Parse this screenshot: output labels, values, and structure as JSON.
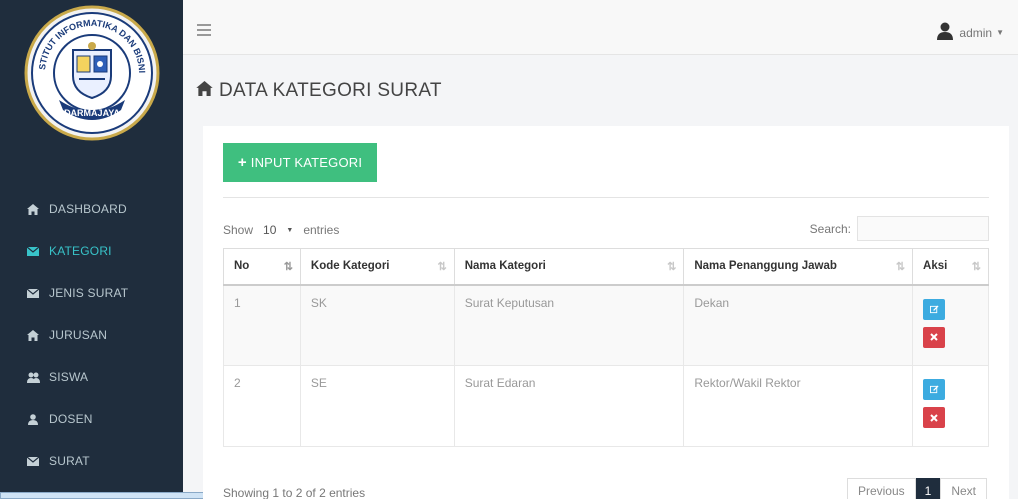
{
  "sidebar": {
    "logo_text_top": "INSTITUT INFORMATIKA DAN BISNIS",
    "logo_text_bottom": "DARMAJAYA",
    "items": [
      {
        "label": "DASHBOARD",
        "icon": "home-icon"
      },
      {
        "label": "KATEGORI",
        "icon": "envelope-icon",
        "active": true
      },
      {
        "label": "JENIS SURAT",
        "icon": "envelope-icon"
      },
      {
        "label": "JURUSAN",
        "icon": "home-icon"
      },
      {
        "label": "SISWA",
        "icon": "users-icon"
      },
      {
        "label": "DOSEN",
        "icon": "user-icon"
      },
      {
        "label": "SURAT",
        "icon": "envelope-icon"
      }
    ]
  },
  "topbar": {
    "user_name": "admin"
  },
  "page": {
    "title": "DATA KATEGORI SURAT"
  },
  "panel": {
    "add_button_label": "INPUT KATEGORI",
    "show_label": "Show",
    "entries_value": "10",
    "entries_label": "entries",
    "search_label": "Search:",
    "search_value": ""
  },
  "table": {
    "headers": [
      "No",
      "Kode Kategori",
      "Nama Kategori",
      "Nama Penanggung Jawab",
      "Aksi"
    ],
    "rows": [
      {
        "no": "1",
        "kode": "SK",
        "nama": "Surat Keputusan",
        "pj": "Dekan"
      },
      {
        "no": "2",
        "kode": "SE",
        "nama": "Surat Edaran",
        "pj": "Rektor/Wakil Rektor"
      }
    ]
  },
  "footer": {
    "info": "Showing 1 to 2 of 2 entries",
    "prev": "Previous",
    "page": "1",
    "next": "Next"
  },
  "colors": {
    "sidebar_bg": "#1f2d3d",
    "active_item": "#38c3c9",
    "add_button": "#3fbf7f",
    "edit_button": "#3cabe0",
    "delete_button": "#d9424a"
  }
}
